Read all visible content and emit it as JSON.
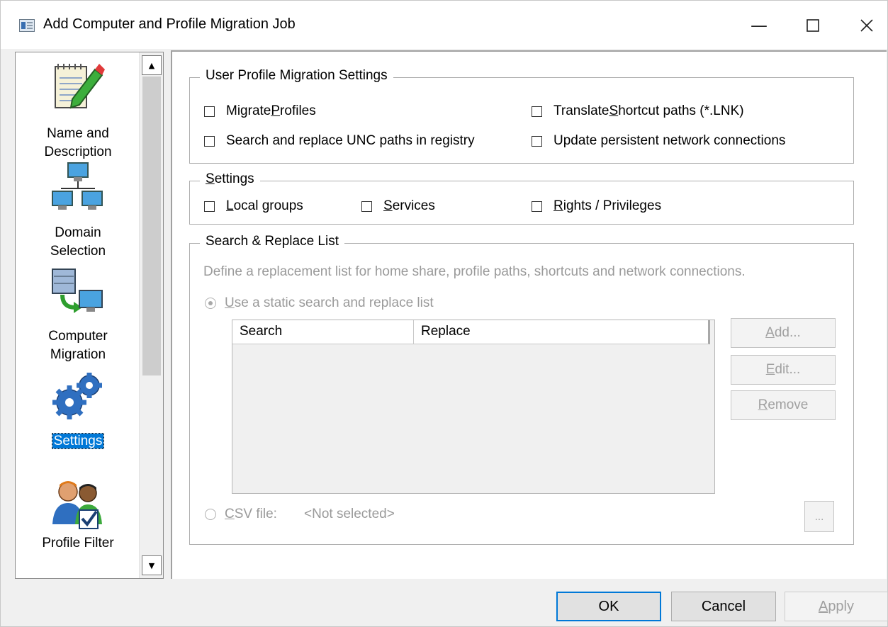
{
  "window": {
    "title": "Add Computer and Profile Migration Job",
    "controls": [
      "minimize",
      "maximize",
      "close"
    ]
  },
  "nav": {
    "items": [
      {
        "label_line1": "Name and",
        "label_line2": "Description",
        "icon": "notepad-pencil-icon",
        "selected": false
      },
      {
        "label_line1": "Domain",
        "label_line2": "Selection",
        "icon": "network-computers-icon",
        "selected": false
      },
      {
        "label_line1": "Computer",
        "label_line2": "Migration",
        "icon": "server-migration-icon",
        "selected": false
      },
      {
        "label_line1": "Settings",
        "label_line2": "",
        "icon": "gears-icon",
        "selected": true
      },
      {
        "label_line1": "Profile Filter",
        "label_line2": "",
        "icon": "users-check-icon",
        "selected": false
      }
    ]
  },
  "profile_group": {
    "title": "User Profile Migration Settings",
    "migrate_profiles": {
      "pre": "Migrate ",
      "key": "P",
      "post": "rofiles",
      "checked": false
    },
    "search_replace_unc": {
      "label": "Search and replace UNC paths in registry",
      "checked": false
    },
    "translate_shortcut": {
      "pre": "Translate ",
      "key": "S",
      "post": "hortcut paths (*.LNK)",
      "checked": false
    },
    "update_persistent": {
      "label": "Update persistent network connections",
      "checked": false
    }
  },
  "settings_group": {
    "title_key": "S",
    "title_rest": "ettings",
    "local_groups": {
      "key": "L",
      "post": "ocal groups",
      "checked": false
    },
    "services": {
      "key": "S",
      "post": "ervices",
      "checked": false
    },
    "rights": {
      "key": "R",
      "post": "ights / Privileges",
      "checked": false
    }
  },
  "search_replace_group": {
    "title": "Search & Replace List",
    "description": "Define a replacement list for home share, profile paths, shortcuts and network connections.",
    "static_radio": {
      "key": "U",
      "post": "se a static search and replace list",
      "selected": true
    },
    "columns": [
      "Search",
      "Replace"
    ],
    "rows": [],
    "buttons": {
      "add": {
        "key": "A",
        "post": "dd..."
      },
      "edit": {
        "key": "E",
        "post": "dit..."
      },
      "remove": {
        "key": "R",
        "post": "emove"
      }
    },
    "csv_radio": {
      "key": "C",
      "post": "SV file:",
      "selected": false
    },
    "csv_value": "<Not selected>",
    "browse_label": "..."
  },
  "dialog_buttons": {
    "ok": "OK",
    "cancel": "Cancel",
    "apply_key": "A",
    "apply_post": "pply"
  }
}
